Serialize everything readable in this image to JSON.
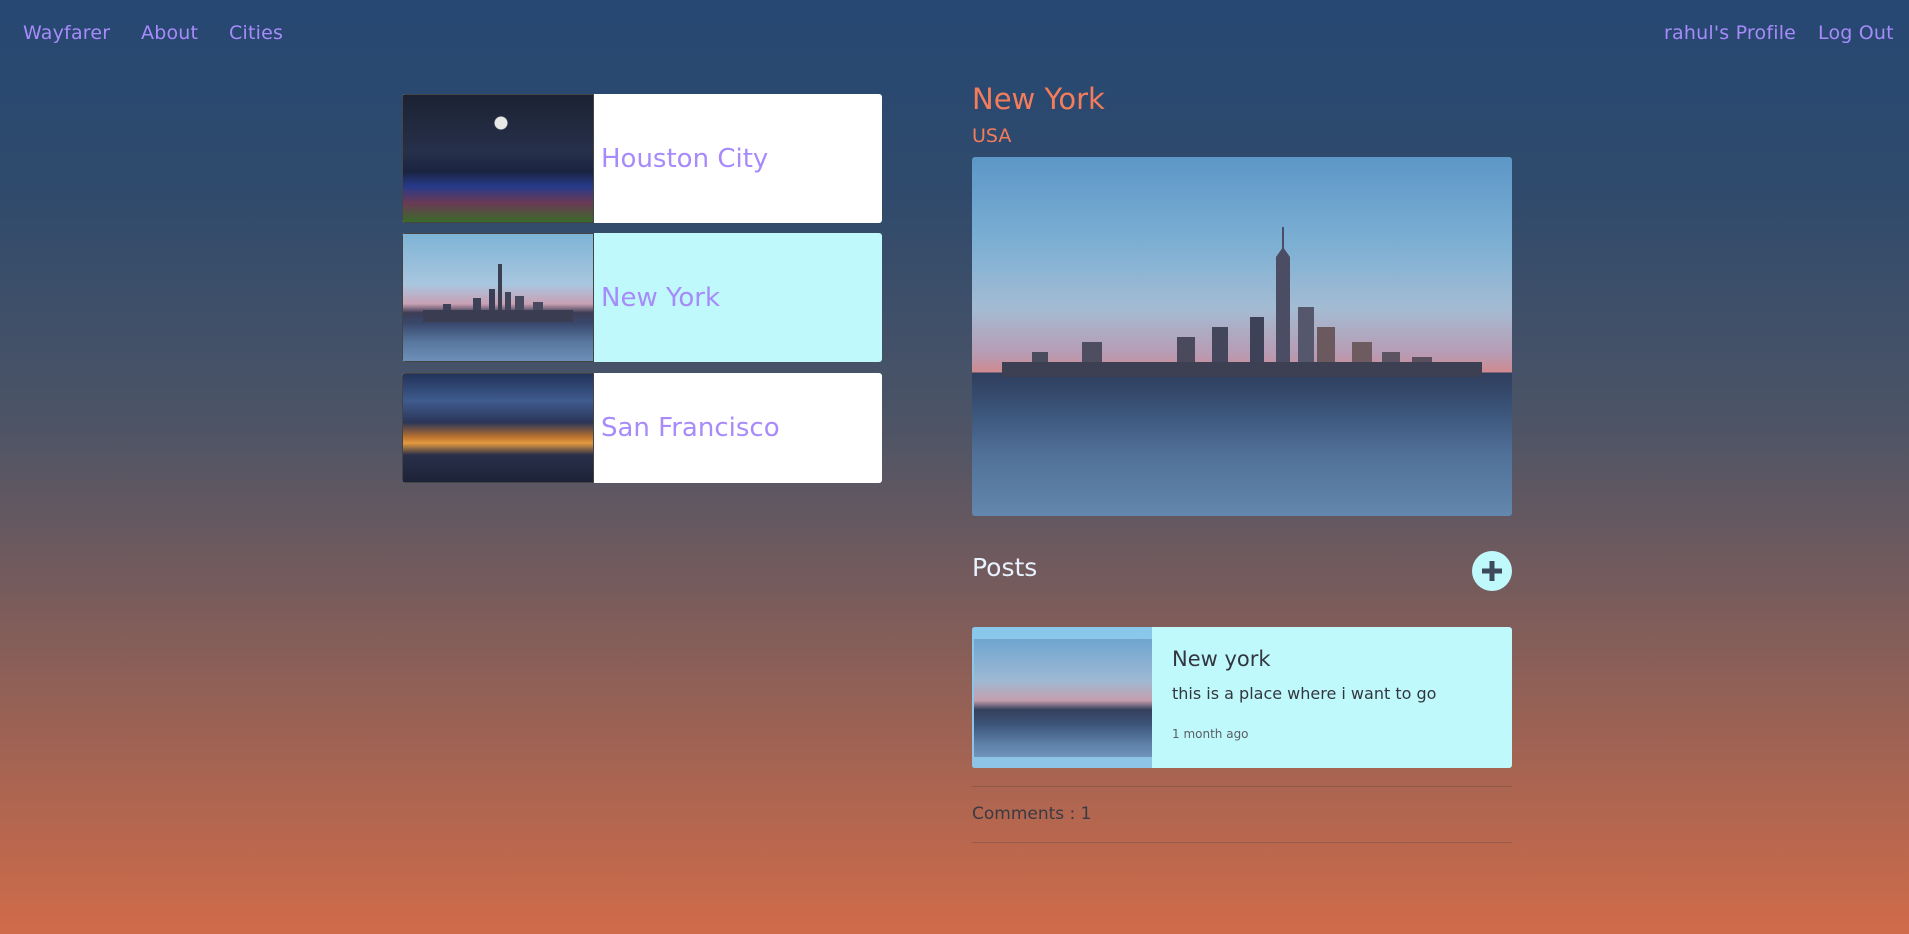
{
  "nav": {
    "brand": "Wayfarer",
    "about": "About",
    "cities": "Cities",
    "profile": "rahul's Profile",
    "logout": "Log Out"
  },
  "cities_list": [
    {
      "name": "Houston City",
      "selected": false
    },
    {
      "name": "New York",
      "selected": true
    },
    {
      "name": "San Francisco",
      "selected": false
    }
  ],
  "city_detail": {
    "name": "New York",
    "country": "USA"
  },
  "posts": {
    "title": "Posts",
    "add_icon": "plus-circle-icon",
    "items": [
      {
        "title": "New york",
        "body": "this is a place where i want to go",
        "time": "1 month ago"
      }
    ],
    "comments_label": "Comments : 1"
  },
  "colors": {
    "link": "#a78bfa",
    "accent": "#f47c5b",
    "selected_card": "#bff9fb",
    "card": "#ffffff"
  }
}
